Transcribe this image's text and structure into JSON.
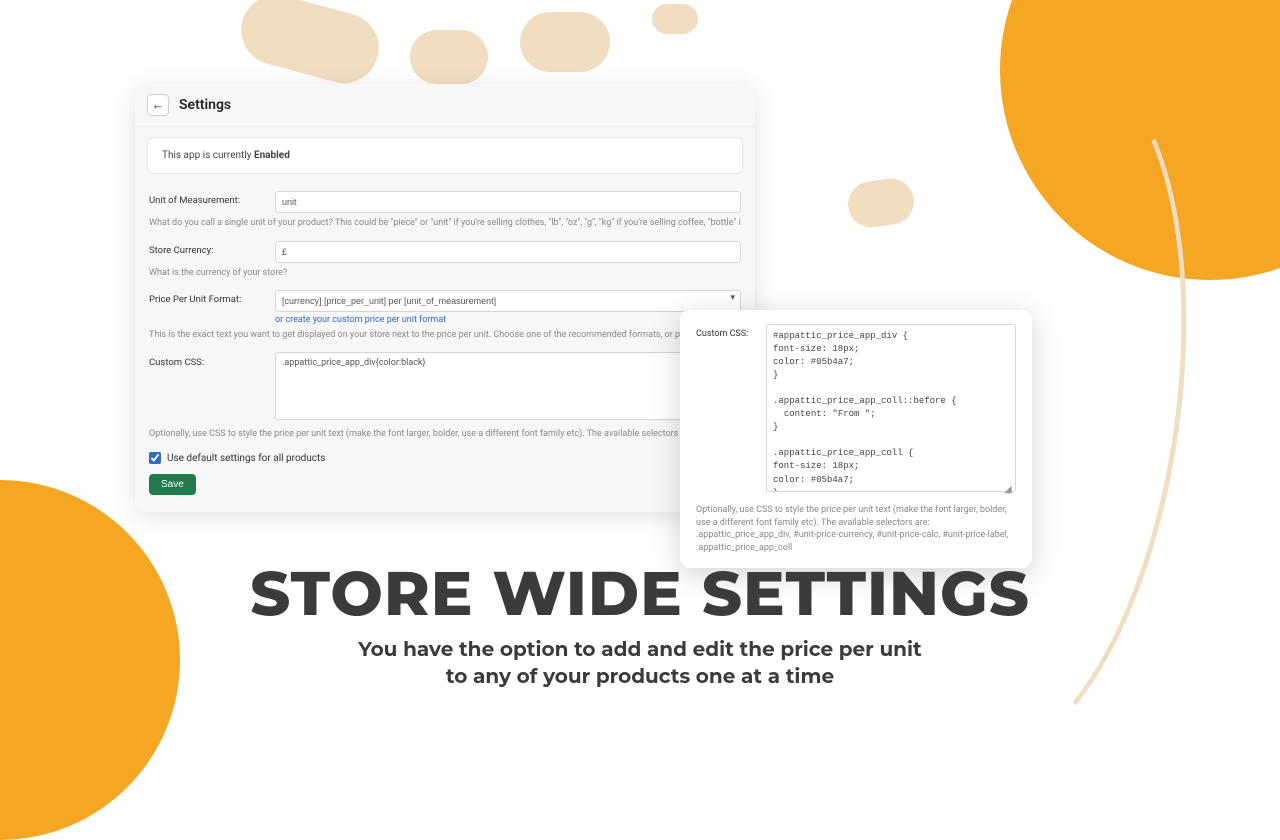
{
  "header": {
    "title": "Settings"
  },
  "status": {
    "prefix": "This app is currently ",
    "state": "Enabled"
  },
  "fields": {
    "unit": {
      "label": "Unit of Measurement:",
      "value": "unit",
      "help": "What do you call a single unit of your product? This could be \"piece\" or \"unit\" if you're selling clothes, \"lb\", \"oz\", \"g\", \"kg\" if you're selling coffee, \"bottle\" if you're selling wine, \"sq. ft.\" if you're selling floori"
    },
    "currency": {
      "label": "Store Currency:",
      "value": "£",
      "help": "What is the currency of your store?"
    },
    "format": {
      "label": "Price Per Unit Format:",
      "value": "[currency] [price_per_unit] per [unit_of_measurement]",
      "link": "or create your custom price per unit format",
      "help": "This is the exact text you want to get displayed on your store next to the price per unit. Choose one of the recommended formats, or provide your own custom format."
    },
    "css": {
      "label": "Custom CSS:",
      "value": ".appattic_price_app_div{color:black}",
      "help": "Optionally, use CSS to style the price per unit text (make the font larger, bolder, use a different font family etc). The available selectors are: .appattic_price_app_div, #unit-price-curre .appattic_price_app_coll"
    }
  },
  "checkbox": {
    "label": "Use default settings for all products",
    "checked": true
  },
  "save": "Save",
  "popout": {
    "label": "Custom CSS:",
    "value": "#appattic_price_app_div {\nfont-size: 18px;\ncolor: #05b4a7;\n}\n\n.appattic_price_app_coll::before {\n  content: \"From \";\n}\n\n.appattic_price_app_coll {\nfont-size: 18px;\ncolor: #05b4a7;\n}",
    "help": "Optionally, use CSS to style the price per unit text (make the font larger, bolder, use a different font family etc). The available selectors are: .appattic_price_app_div, #unit-price-currency, #unit-price-calc, #unit-price-label, .appattic_price_app_coll"
  },
  "headline": {
    "title": "STORE WIDE SETTINGS",
    "line1": "You have the option to add and edit the price per unit",
    "line2": "to any of your products one at a time"
  }
}
